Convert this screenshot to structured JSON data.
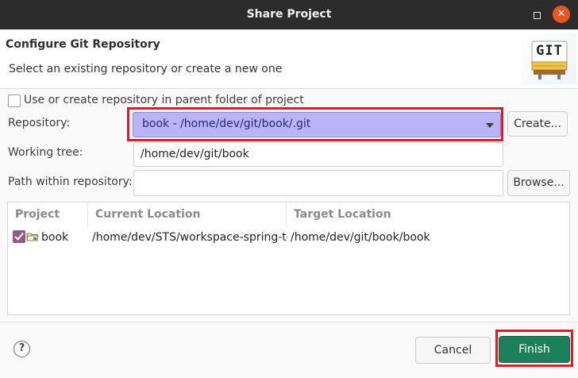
{
  "window": {
    "title": "Share Project",
    "close_glyph": "✕"
  },
  "banner": {
    "title": "Configure Git Repository",
    "subtitle": "Select an existing repository or create a new one",
    "logo_text": "GIT"
  },
  "parent_repo_option": {
    "label": "Use or create repository in parent folder of project",
    "checked": false
  },
  "repository": {
    "label": "Repository:",
    "selected": "book - /home/dev/git/book/.git",
    "create_label": "Create..."
  },
  "working_tree": {
    "label": "Working tree:",
    "value": "/home/dev/git/book"
  },
  "path_within": {
    "label": "Path within repository:",
    "value": "",
    "browse_label": "Browse..."
  },
  "table": {
    "columns": [
      "Project",
      "Current Location",
      "Target Location"
    ],
    "rows": [
      {
        "checked": true,
        "project": "book",
        "current": "/home/dev/STS/workspace-spring-to",
        "target": "/home/dev/git/book/book"
      }
    ]
  },
  "footer": {
    "help_glyph": "?",
    "cancel_label": "Cancel",
    "finish_label": "Finish"
  },
  "colors": {
    "highlight": "#e01b24",
    "finish": "#1e7f5c",
    "combo": "#b9b5f5"
  }
}
